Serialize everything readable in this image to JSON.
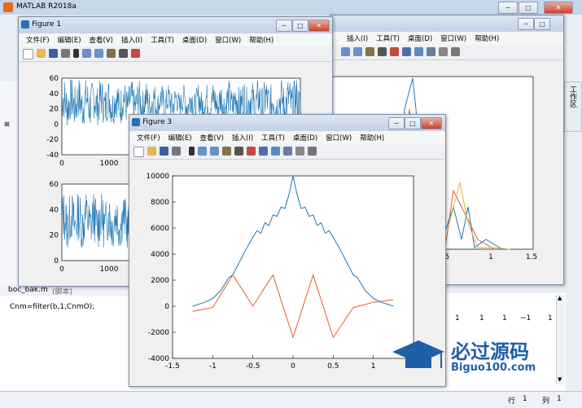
{
  "app": {
    "title": "MATLAB R2018a"
  },
  "cmd_window": {
    "file_label": "boc_bak.m",
    "file_suffix": "(脚本)",
    "line1": "Cnm=filter(b,1,CnmO);",
    "right_values": [
      "1",
      "1",
      "1",
      "−1",
      "1"
    ]
  },
  "status": {
    "row_label": "行",
    "row_value": "1",
    "col_label": "列",
    "col_value": "1"
  },
  "side_tab": "工作区",
  "menus": [
    "文件(F)",
    "编辑(E)",
    "查看(V)",
    "插入(I)",
    "工具(T)",
    "桌面(D)",
    "窗口(W)",
    "帮助(H)"
  ],
  "fig_back_menus": [
    "插入(I)",
    "工具(T)",
    "桌面(D)",
    "窗口(W)",
    "帮助(H)"
  ],
  "figure1": {
    "title": "Figure 1",
    "top_plot": {
      "yticks": [
        "60",
        "40",
        "20",
        "0",
        "-20",
        "-40"
      ],
      "xticks": [
        "0",
        "1000",
        "2000",
        "3"
      ]
    },
    "bottom_plot": {
      "yticks": [
        "60",
        "40",
        "20",
        "0"
      ],
      "xticks": [
        "0",
        "1000",
        "2000",
        "3"
      ]
    }
  },
  "figure2": {
    "xticks": [
      "0.5",
      "1",
      "1.5"
    ]
  },
  "figure3": {
    "title": "Figure 3",
    "chart_data": {
      "type": "line",
      "title": "",
      "xlabel": "",
      "ylabel": "",
      "xlim": [
        -1.5,
        1.5
      ],
      "ylim": [
        -4000,
        10000
      ],
      "xticks": [
        "-1.5",
        "-1",
        "-0.5",
        "0",
        "0.5",
        "1",
        "1.5"
      ],
      "yticks": [
        "10000",
        "8000",
        "6000",
        "4000",
        "2000",
        "0",
        "-2000",
        "-4000"
      ],
      "series": [
        {
          "color": "#1f77b4",
          "x": [
            -1.25,
            -1.1,
            -1.0,
            -0.9,
            -0.8,
            -0.75,
            -0.7,
            -0.6,
            -0.5,
            -0.45,
            -0.4,
            -0.35,
            -0.3,
            -0.25,
            -0.2,
            -0.15,
            -0.1,
            -0.05,
            0,
            0.05,
            0.1,
            0.15,
            0.2,
            0.25,
            0.3,
            0.35,
            0.4,
            0.45,
            0.5,
            0.6,
            0.7,
            0.75,
            0.8,
            0.9,
            1.0,
            1.1,
            1.25
          ],
          "y": [
            0,
            300,
            600,
            1200,
            2200,
            2400,
            3000,
            4200,
            5300,
            5800,
            5600,
            6400,
            6200,
            7000,
            6900,
            7600,
            7500,
            8600,
            10000,
            8600,
            7500,
            7600,
            6900,
            7000,
            6200,
            6400,
            5600,
            5800,
            5300,
            4200,
            3000,
            2400,
            2200,
            1200,
            600,
            300,
            0
          ]
        },
        {
          "color": "#e0602a",
          "x": [
            -1.25,
            -1.0,
            -0.75,
            -0.5,
            -0.25,
            0,
            0.25,
            0.5,
            0.75,
            1.0,
            1.25
          ],
          "y": [
            -400,
            -100,
            2400,
            0,
            2400,
            -2400,
            2400,
            -2400,
            -100,
            300,
            500
          ]
        }
      ]
    }
  },
  "watermark": {
    "text": "必过源码",
    "url": "Biguo100.com"
  }
}
